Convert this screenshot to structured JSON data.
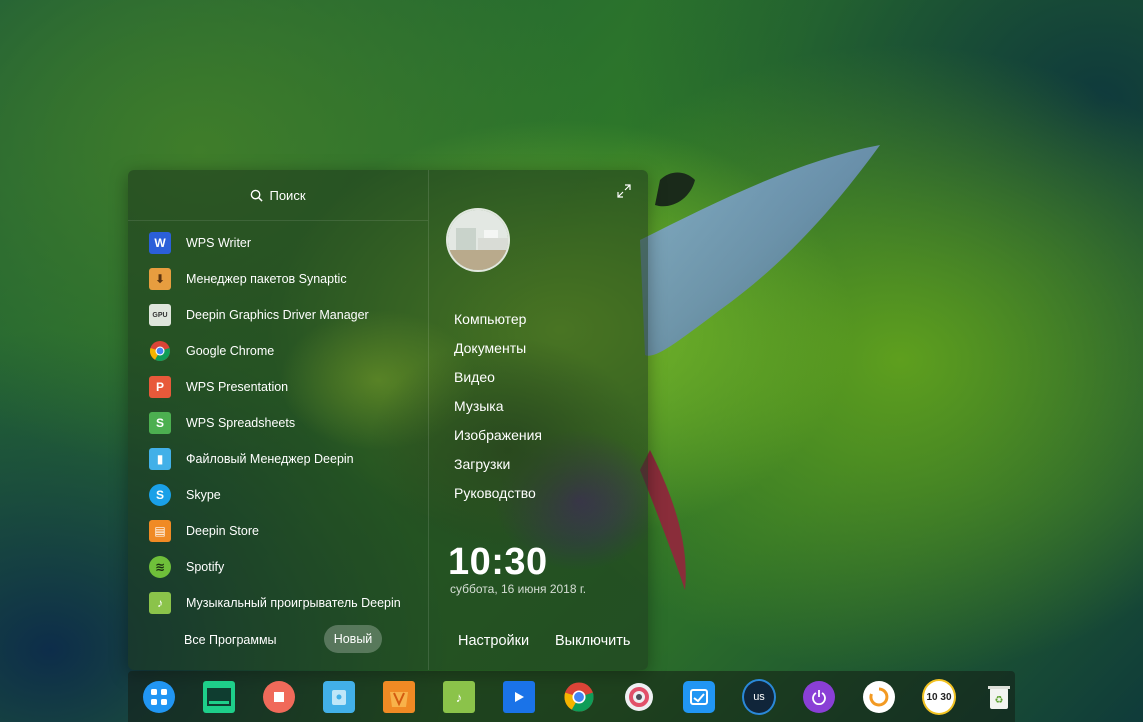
{
  "search": {
    "label": "Поиск"
  },
  "apps": [
    {
      "label": "WPS Writer",
      "icon": "wps-writer-icon",
      "color": "#2b5fd9",
      "glyph": "W"
    },
    {
      "label": "Менеджер пакетов Synaptic",
      "icon": "synaptic-icon",
      "color": "#e79d3f",
      "glyph": "⬇"
    },
    {
      "label": "Deepin Graphics Driver Manager",
      "icon": "gpu-driver-icon",
      "color": "#dfe6dc",
      "glyph": "GPU"
    },
    {
      "label": "Google Chrome",
      "icon": "chrome-icon",
      "color": "#ffffff",
      "glyph": ""
    },
    {
      "label": "WPS Presentation",
      "icon": "wps-presentation-icon",
      "color": "#e8593a",
      "glyph": "P"
    },
    {
      "label": "WPS Spreadsheets",
      "icon": "wps-spreadsheets-icon",
      "color": "#4caf50",
      "glyph": "S"
    },
    {
      "label": "Файловый Менеджер Deepin",
      "icon": "file-manager-icon",
      "color": "#42b0e8",
      "glyph": "▮"
    },
    {
      "label": "Skype",
      "icon": "skype-icon",
      "color": "#1aa0e8",
      "glyph": "S"
    },
    {
      "label": "Deepin Store",
      "icon": "deepin-store-icon",
      "color": "#f08a24",
      "glyph": "▤"
    },
    {
      "label": "Spotify",
      "icon": "spotify-icon",
      "color": "#6fbf3a",
      "glyph": "≋"
    },
    {
      "label": "Музыкальный проигрыватель Deepin",
      "icon": "music-player-icon",
      "color": "#8bc34a",
      "glyph": "♪"
    }
  ],
  "bottom": {
    "all_programs": "Все Программы",
    "new": "Новый"
  },
  "folders": [
    "Компьютер",
    "Документы",
    "Видео",
    "Музыка",
    "Изображения",
    "Загрузки",
    "Руководство"
  ],
  "clock": {
    "time": "10:30",
    "date": "суббота, 16 июня 2018 г."
  },
  "actions": {
    "settings": "Настройки",
    "poweroff": "Выключить"
  },
  "dock": [
    {
      "icon": "launcher-icon",
      "color": "#2196f3"
    },
    {
      "icon": "terminal-icon",
      "color": "#1ecf8a"
    },
    {
      "icon": "screen-recorder-icon",
      "color": "#f06a5a"
    },
    {
      "icon": "file-manager-icon",
      "color": "#42b0e8"
    },
    {
      "icon": "deepin-store-icon",
      "color": "#f08a24"
    },
    {
      "icon": "music-player-icon",
      "color": "#8bc34a"
    },
    {
      "icon": "movie-icon",
      "color": "#1a73e8"
    },
    {
      "icon": "chrome-icon",
      "color": "#ffffff"
    },
    {
      "icon": "control-center-icon",
      "color": "#ffffff"
    },
    {
      "icon": "system-monitor-icon",
      "color": "#2196f3"
    },
    {
      "icon": "keyboard-layout-icon",
      "color": "#10253a",
      "label": "us"
    },
    {
      "icon": "power-icon",
      "color": "#8a3fd6"
    },
    {
      "icon": "sync-icon",
      "color": "#ffffff"
    },
    {
      "icon": "clock-icon",
      "color": "#ffffff",
      "label": "10 30"
    },
    {
      "icon": "trash-icon",
      "color": "#ffffff"
    }
  ]
}
